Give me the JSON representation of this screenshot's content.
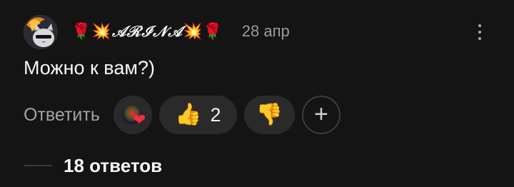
{
  "comment": {
    "author": {
      "name": "𝒜ℛℐ𝒩𝒜",
      "prefix_emoji": [
        "🌹",
        "💥"
      ],
      "suffix_emoji": [
        "💥",
        "🌹"
      ]
    },
    "date": "28 апр",
    "text": "Можно к вам?)",
    "reply_label": "Ответить",
    "reactions": {
      "heart": "❤",
      "like_icon": "👍",
      "like_count": "2",
      "dislike_icon": "👎",
      "add_icon": "+"
    },
    "replies_label": "18 ответов"
  },
  "colors": {
    "background": "#141414",
    "pill": "#2a2a2a",
    "muted_text": "#9a9a9a",
    "heart": "#ff2a3f"
  },
  "icons": {
    "more": "vertical-dots-icon",
    "avatar": "cat-avatar",
    "like": "thumbs-up-icon",
    "dislike": "thumbs-down-icon",
    "add": "plus-icon"
  }
}
